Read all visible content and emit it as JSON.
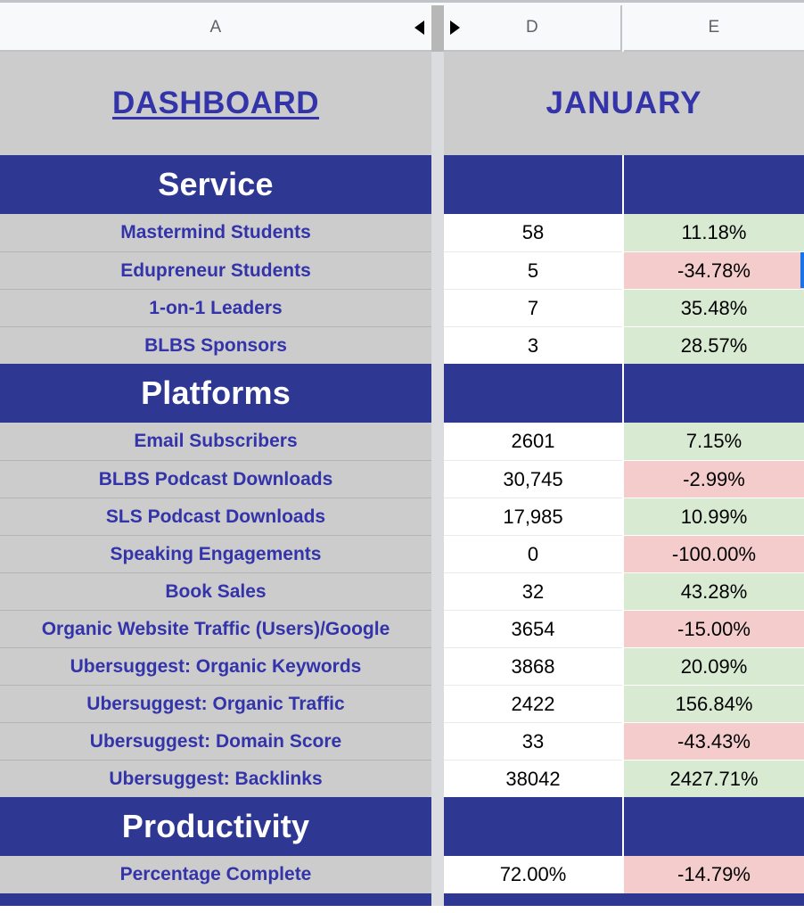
{
  "column_headers": [
    {
      "id": "A",
      "label": "A",
      "collapse_arrow": "left-triangle"
    },
    {
      "id": "D",
      "label": "D",
      "collapse_arrow": "right-triangle"
    },
    {
      "id": "E",
      "label": "E",
      "collapse_arrow": "none"
    }
  ],
  "title_row": {
    "dashboard_label": "DASHBOARD",
    "month_label": "JANUARY"
  },
  "colors": {
    "section_header_bg": "#2e3892",
    "label_cell_bg": "#cccccc",
    "label_text": "#3333aa",
    "positive_bg": "#d9ead3",
    "negative_bg": "#f4cccc",
    "value_bg": "#ffffff",
    "selection_border": "#1a73e8",
    "column_gap": "#dadce0",
    "column_header_bg": "#f8f9fa",
    "column_header_text": "#5f6368"
  },
  "sections": [
    {
      "name": "Service",
      "rows": [
        {
          "label": "Mastermind Students",
          "value": "58",
          "delta": "11.18%",
          "delta_sign": "positive",
          "selected": false
        },
        {
          "label": "Edupreneur Students",
          "value": "5",
          "delta": "-34.78%",
          "delta_sign": "negative",
          "selected": true
        },
        {
          "label": "1-on-1 Leaders",
          "value": "7",
          "delta": "35.48%",
          "delta_sign": "positive",
          "selected": false
        },
        {
          "label": "BLBS Sponsors",
          "value": "3",
          "delta": "28.57%",
          "delta_sign": "positive",
          "selected": false
        }
      ]
    },
    {
      "name": "Platforms",
      "rows": [
        {
          "label": "Email Subscribers",
          "value": "2601",
          "delta": "7.15%",
          "delta_sign": "positive",
          "selected": false
        },
        {
          "label": "BLBS Podcast Downloads",
          "value": "30,745",
          "delta": "-2.99%",
          "delta_sign": "negative",
          "selected": false
        },
        {
          "label": "SLS Podcast Downloads",
          "value": "17,985",
          "delta": "10.99%",
          "delta_sign": "positive",
          "selected": false
        },
        {
          "label": "Speaking Engagements",
          "value": "0",
          "delta": "-100.00%",
          "delta_sign": "negative",
          "selected": false
        },
        {
          "label": "Book Sales",
          "value": "32",
          "delta": "43.28%",
          "delta_sign": "positive",
          "selected": false
        },
        {
          "label": "Organic Website Traffic (Users)/Google",
          "value": "3654",
          "delta": "-15.00%",
          "delta_sign": "negative",
          "selected": false
        },
        {
          "label": "Ubersuggest: Organic Keywords",
          "value": "3868",
          "delta": "20.09%",
          "delta_sign": "positive",
          "selected": false
        },
        {
          "label": "Ubersuggest: Organic Traffic",
          "value": "2422",
          "delta": "156.84%",
          "delta_sign": "positive",
          "selected": false
        },
        {
          "label": "Ubersuggest: Domain Score",
          "value": "33",
          "delta": "-43.43%",
          "delta_sign": "negative",
          "selected": false
        },
        {
          "label": "Ubersuggest: Backlinks",
          "value": "38042",
          "delta": "2427.71%",
          "delta_sign": "positive",
          "selected": false
        }
      ]
    },
    {
      "name": "Productivity",
      "rows": [
        {
          "label": "Percentage Complete",
          "value": "72.00%",
          "delta": "-14.79%",
          "delta_sign": "negative",
          "selected": false
        }
      ]
    }
  ]
}
